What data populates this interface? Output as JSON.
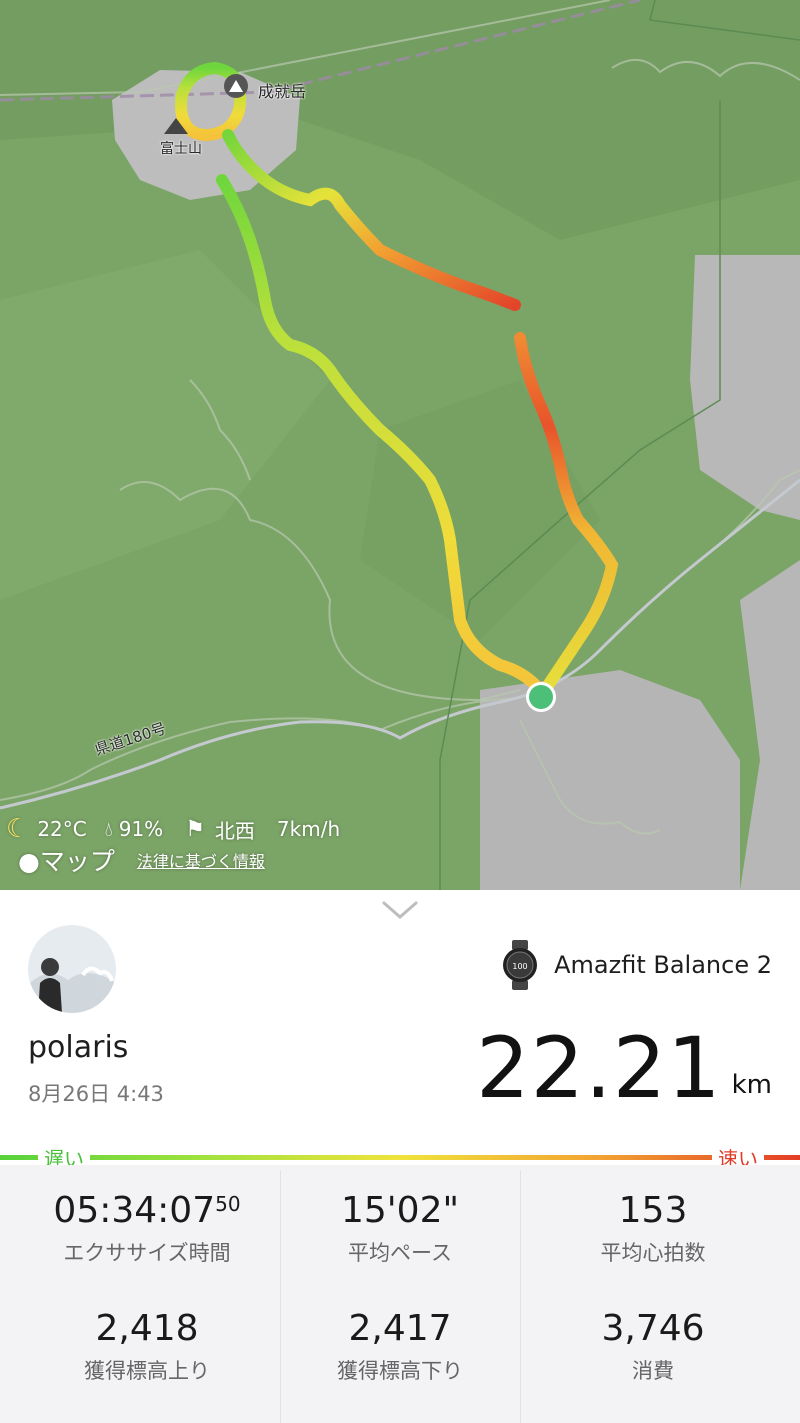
{
  "map": {
    "labels": {
      "peak_shizu": "成就岳",
      "fuji": "富士山",
      "road": "県道180号"
    },
    "route_colors": {
      "slow": "#58d13b",
      "fast": "#e33d25"
    },
    "weather": {
      "temperature": "22°C",
      "humidity": "91%",
      "wind_direction": "北西",
      "wind_speed": "7km/h"
    },
    "attribution": {
      "maps": "マップ",
      "legal": "法律に基づく情報"
    }
  },
  "workout": {
    "user": "polaris",
    "date": "8月26日 4:43",
    "device": "Amazfit Balance 2",
    "distance": "22.21",
    "distance_unit": "km"
  },
  "pace_legend": {
    "slow": "遅い",
    "fast": "速い"
  },
  "stats": [
    {
      "value": "05:34:07",
      "sub": "50",
      "label": "エクササイズ時間"
    },
    {
      "value": "15'02\"",
      "label": "平均ペース"
    },
    {
      "value": "153",
      "label": "平均心拍数"
    },
    {
      "value": "2,418",
      "label": "獲得標高上り"
    },
    {
      "value": "2,417",
      "label": "獲得標高下り"
    },
    {
      "value": "3,746",
      "label": "消費"
    }
  ]
}
